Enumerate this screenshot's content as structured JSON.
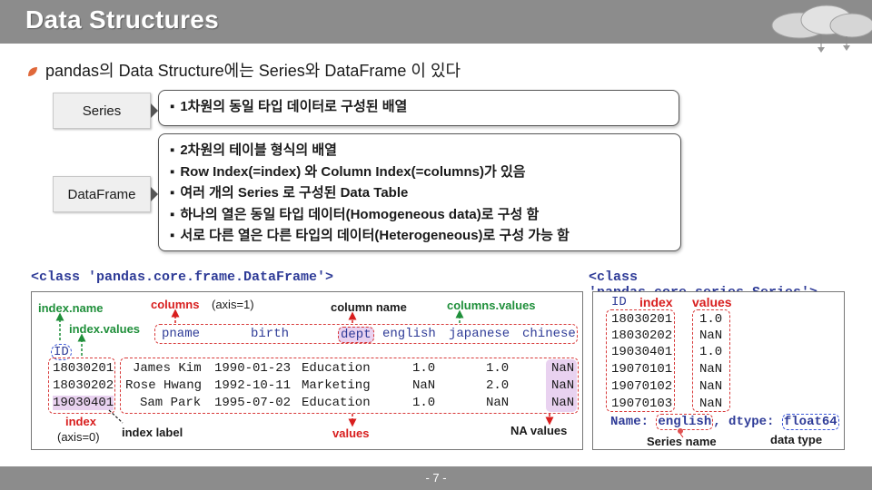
{
  "title": "Data Structures",
  "intro": "pandas의 Data Structure에는 Series와 DataFrame 이 있다",
  "series_label": "Series",
  "series_desc": "1차원의 동일 타입 데이터로 구성된 배열",
  "dataframe_label": "DataFrame",
  "dataframe_desc": [
    "2차원의 테이블 형식의 배열",
    "Row Index(=index) 와 Column Index(=columns)가 있음",
    "여러 개의 Series 로 구성된 Data Table",
    "하나의 열은 동일 타입 데이터(Homogeneous data)로 구성 함",
    "서로 다른 열은 다른 타입의 데이터(Heterogeneous)로 구성 가능 함"
  ],
  "df_class": "<class 'pandas.core.frame.DataFrame'>",
  "s_class": "<class 'pandas.core.series.Series'>",
  "df": {
    "ann": {
      "index_name": "index.name",
      "index_values": "index.values",
      "columns": "columns",
      "axis1": "(axis=1)",
      "column_name": "column name",
      "columns_values": "columns.values",
      "index": "index",
      "axis0": "(axis=0)",
      "index_label": "index label",
      "values": "values",
      "na_values": "NA values"
    },
    "index_name": "ID",
    "columns": [
      "pname",
      "birth",
      "dept",
      "english",
      "japanese",
      "chinese"
    ],
    "rows": [
      {
        "id": "18030201",
        "pname": "James Kim",
        "birth": "1990-01-23",
        "dept": "Education",
        "english": "1.0",
        "japanese": "1.0",
        "chinese": "NaN"
      },
      {
        "id": "18030202",
        "pname": "Rose Hwang",
        "birth": "1992-10-11",
        "dept": "Marketing",
        "english": "NaN",
        "japanese": "2.0",
        "chinese": "NaN"
      },
      {
        "id": "19030401",
        "pname": "Sam Park",
        "birth": "1995-07-02",
        "dept": "Education",
        "english": "1.0",
        "japanese": "NaN",
        "chinese": "NaN"
      }
    ]
  },
  "series": {
    "ann": {
      "index": "index",
      "values": "values",
      "series_name": "Series name",
      "data_type": "data type"
    },
    "index_name": "ID",
    "rows": [
      {
        "id": "18030201",
        "value": "1.0"
      },
      {
        "id": "18030202",
        "value": "NaN"
      },
      {
        "id": "19030401",
        "value": "1.0"
      },
      {
        "id": "19070101",
        "value": "NaN"
      },
      {
        "id": "19070102",
        "value": "NaN"
      },
      {
        "id": "19070103",
        "value": "NaN"
      }
    ],
    "name_prefix": "Name: ",
    "name": "english",
    "dtype_prefix": ", dtype: ",
    "dtype": "float64"
  },
  "page_number": "- 7 -",
  "colors": {
    "green": "#1f8f3a",
    "red": "#d81e1e",
    "blue": "#2e3b97",
    "purple_highlight": "#e9d2f0",
    "title_bar": "#8c8c8c"
  },
  "icons": {
    "bullet": "leaf-icon",
    "cloud": "cloud-icon"
  }
}
